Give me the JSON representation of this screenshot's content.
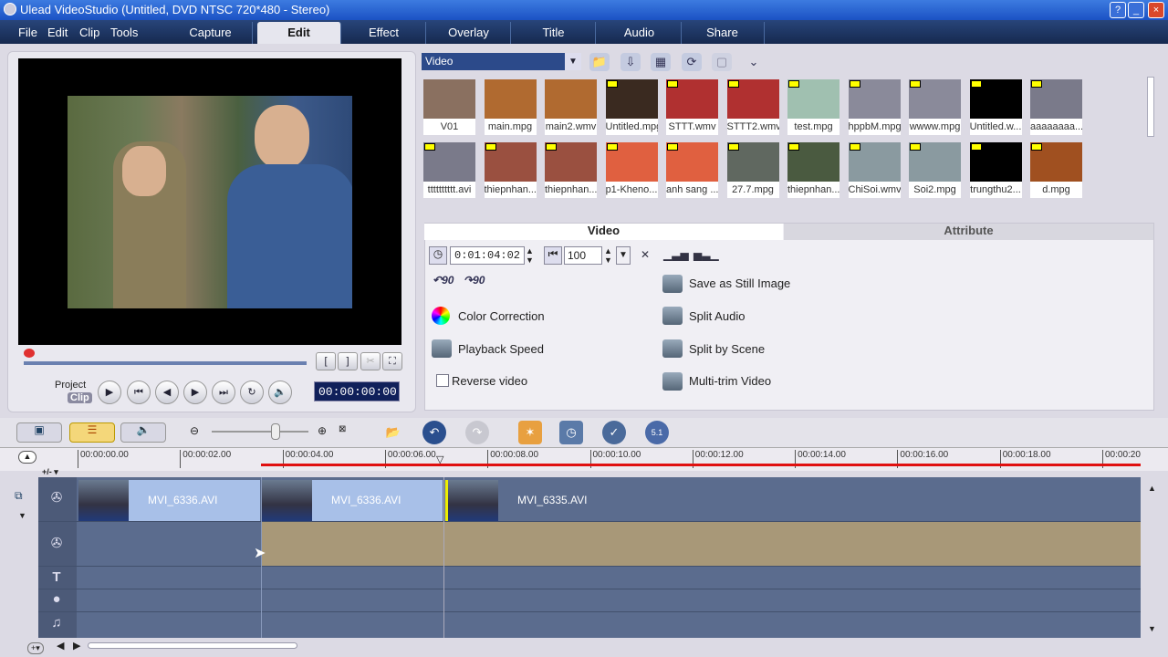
{
  "window": {
    "title": "Ulead VideoStudio (Untitled, DVD NTSC 720*480 - Stereo)",
    "controls": [
      "?",
      "_",
      "□",
      "×"
    ]
  },
  "menu": [
    "File",
    "Edit",
    "Clip",
    "Tools"
  ],
  "tabs": [
    {
      "label": "Capture"
    },
    {
      "label": "Edit",
      "active": true
    },
    {
      "label": "Effect"
    },
    {
      "label": "Overlay"
    },
    {
      "label": "Title"
    },
    {
      "label": "Audio"
    },
    {
      "label": "Share"
    }
  ],
  "preview": {
    "project_label": "Project",
    "clip_label": "Clip",
    "timecode": "00:00:00:00",
    "trim_marks": [
      "[",
      "]"
    ]
  },
  "library": {
    "selected": "Video",
    "items": [
      "V01",
      "main.mpg",
      "main2.wmv",
      "Untitled.mpg",
      "STTT.wmv",
      "STTT2.wmv",
      "test.mpg",
      "hppbM.mpg",
      "wwww.mpg",
      "Untitled.w...",
      "aaaaaaaa...",
      "tttttttttt.avi",
      "thiepnhan...",
      "thiepnhan...",
      "p1-Kheno...",
      "anh sang ...",
      "27.7.mpg",
      "thiepnhan...",
      "ChiSoi.wmv",
      "Soi2.mpg",
      "trungthu2...",
      "d.mpg"
    ]
  },
  "options": {
    "tabs": [
      "Video",
      "Attribute"
    ],
    "duration": "0:01:04:02",
    "volume": "100",
    "rotate_labels": [
      "90",
      "90"
    ],
    "left": [
      "Color Correction",
      "Playback Speed",
      "Reverse video"
    ],
    "right": [
      "Save as Still Image",
      "Split Audio",
      "Split by Scene",
      "Multi-trim Video"
    ]
  },
  "timeline": {
    "ruler": [
      "00:00:00.00",
      "00:00:02.00",
      "00:00:04.00",
      "00:00:06.00",
      "00:00:08.00",
      "00:00:10.00",
      "00:00:12.00",
      "00:00:14.00",
      "00:00:16.00",
      "00:00:18.00",
      "00:00:20"
    ],
    "add_label": "+/- ▾",
    "clips": [
      "MVI_6336.AVI",
      "MVI_6336.AVI",
      "MVI_6335.AVI"
    ]
  },
  "colors": {
    "accent": "#1b52c4",
    "selected_clip": "#a8c0e8",
    "overlay_track": "#a89878",
    "red_bar": "#e01010"
  }
}
